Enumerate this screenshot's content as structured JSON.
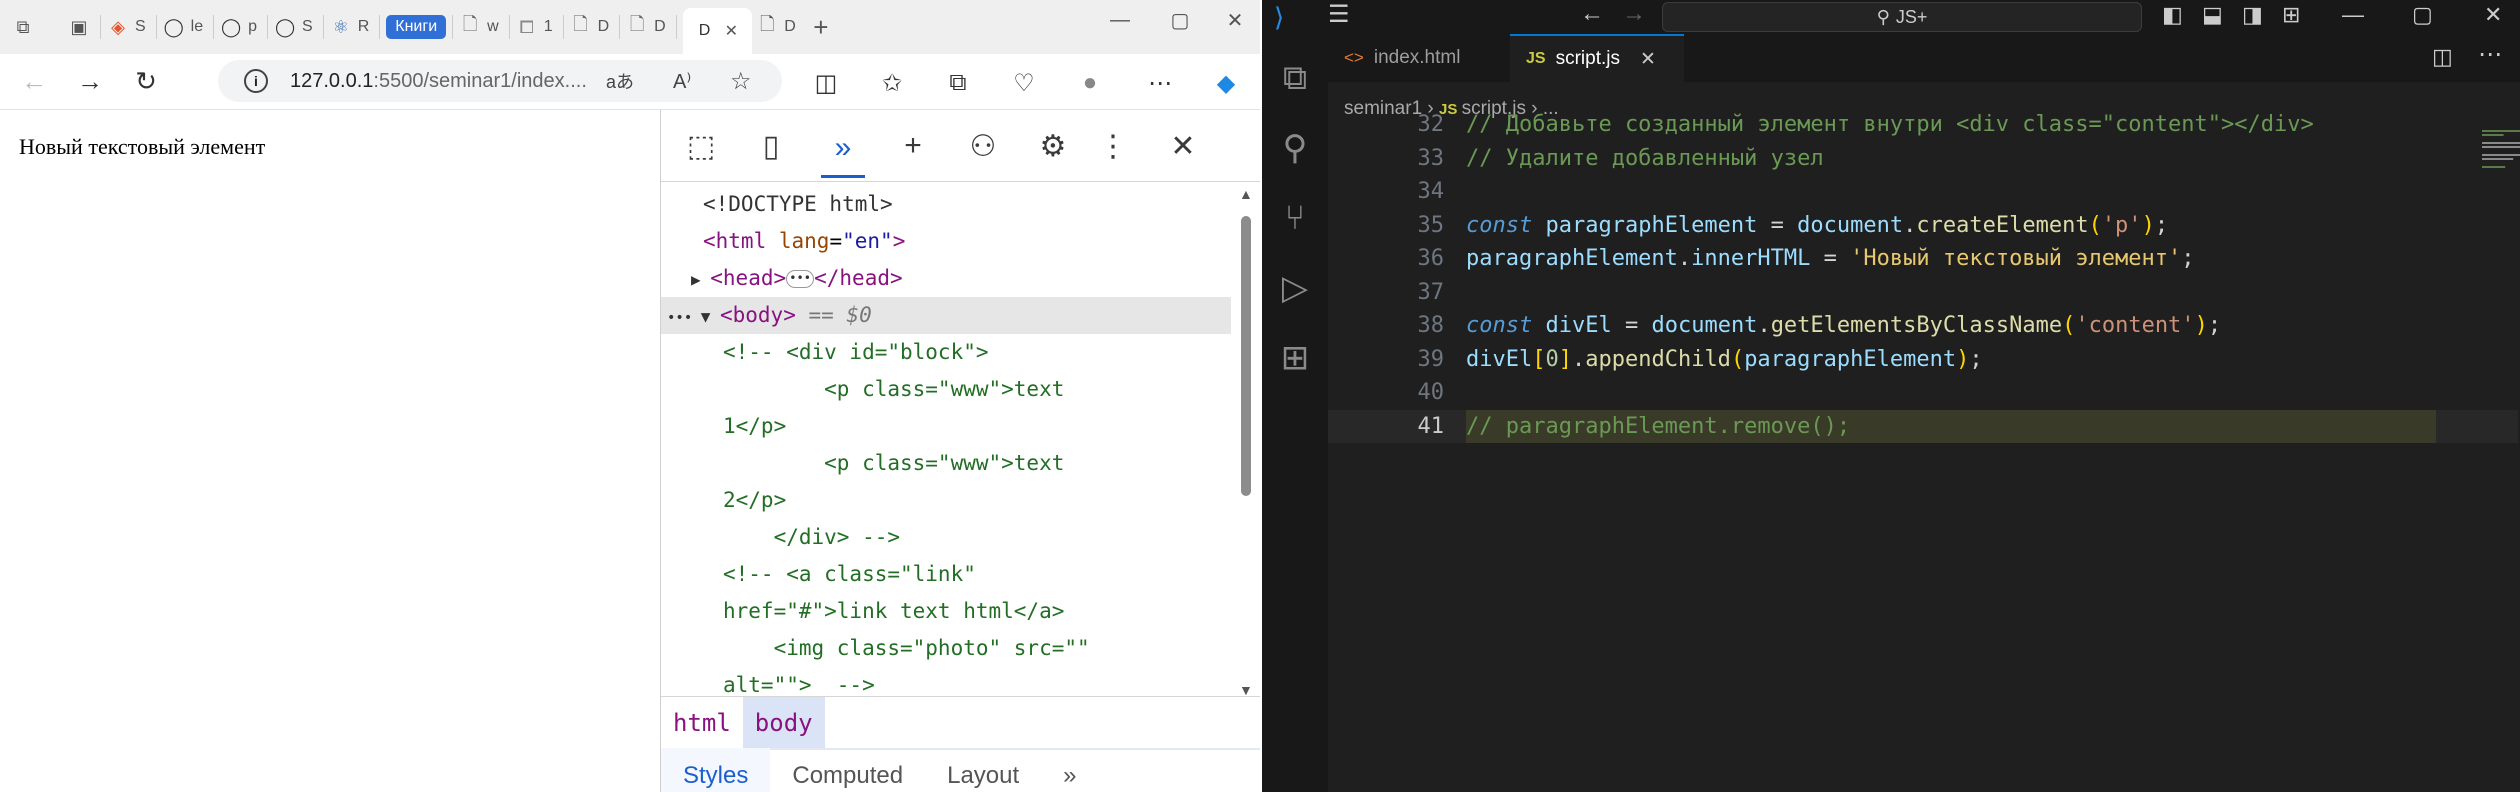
{
  "browser": {
    "tabs": [
      {
        "icon": "figma-icon",
        "title": "S"
      },
      {
        "icon": "github-icon",
        "title": "le"
      },
      {
        "icon": "github-icon",
        "title": "p"
      },
      {
        "icon": "github-icon",
        "title": "S"
      },
      {
        "icon": "react-icon",
        "title": "R"
      },
      {
        "icon": "doc-icon",
        "title": "w"
      },
      {
        "icon": "puzzle-icon",
        "title": "1"
      },
      {
        "icon": "doc-icon",
        "title": "D"
      },
      {
        "icon": "doc-icon",
        "title": "D"
      },
      {
        "icon": "doc-icon",
        "title": "D"
      },
      {
        "icon": "doc-icon",
        "title": "D"
      }
    ],
    "tab_group_label": "Книги",
    "url_host": "127.0.0.1",
    "url_rest": ":5500/seminar1/index....",
    "read_aloud": "aあ",
    "page_text": "Новый текстовый элемент"
  },
  "devtools": {
    "dom_lines": [
      {
        "kind": "doctype",
        "text": "<!DOCTYPE html>"
      },
      {
        "kind": "html",
        "open": "<html",
        "attr": "lang",
        "val": "\"en\"",
        "close": ">"
      },
      {
        "kind": "head",
        "open": "<head>",
        "close": "</head>"
      },
      {
        "kind": "body",
        "open": "<body>",
        "eq": "== $0"
      },
      {
        "kind": "cmt",
        "text": "<!-- <div id=\"block\">"
      },
      {
        "kind": "cmt",
        "text": "        <p class=\"www\">text"
      },
      {
        "kind": "cmt",
        "text": "1</p>"
      },
      {
        "kind": "cmt",
        "text": "        <p class=\"www\">text"
      },
      {
        "kind": "cmt",
        "text": "2</p>"
      },
      {
        "kind": "cmt",
        "text": "    </div> -->"
      },
      {
        "kind": "cmt",
        "text": "<!-- <a class=\"link\""
      },
      {
        "kind": "cmt",
        "text": "href=\"#\">link text html</a>"
      },
      {
        "kind": "cmt",
        "text": "    <img class=\"photo\" src=\"\""
      },
      {
        "kind": "cmt",
        "text": "alt=\"\">  -->"
      }
    ],
    "crumbs": [
      "html",
      "body"
    ],
    "style_tabs": [
      "Styles",
      "Computed",
      "Layout"
    ]
  },
  "vscode": {
    "search": "JS+",
    "tabs": [
      {
        "icon": "html-icon",
        "label": "index.html"
      },
      {
        "icon": "js-icon",
        "label": "script.js"
      }
    ],
    "breadcrumb_folder": "seminar1",
    "breadcrumb_file": "script.js",
    "breadcrumb_more": "...",
    "lines": [
      {
        "n": "32",
        "tokens": [
          {
            "c": "vcm",
            "t": "// Добавьте созданный элемент внутри <div class=\"content\"></div>"
          }
        ]
      },
      {
        "n": "33",
        "tokens": [
          {
            "c": "vcm",
            "t": "// Удалите добавленный узел"
          }
        ]
      },
      {
        "n": "34",
        "tokens": []
      },
      {
        "n": "35",
        "tokens": [
          {
            "c": "kw",
            "t": "const "
          },
          {
            "c": "var",
            "t": "paragraphElement "
          },
          {
            "c": "op",
            "t": "= "
          },
          {
            "c": "var",
            "t": "document"
          },
          {
            "c": "op",
            "t": "."
          },
          {
            "c": "fn",
            "t": "createElement"
          },
          {
            "c": "br1",
            "t": "("
          },
          {
            "c": "str",
            "t": "'p'"
          },
          {
            "c": "br1",
            "t": ")"
          },
          {
            "c": "op",
            "t": ";"
          }
        ]
      },
      {
        "n": "36",
        "tokens": [
          {
            "c": "var",
            "t": "paragraphElement"
          },
          {
            "c": "op",
            "t": "."
          },
          {
            "c": "var",
            "t": "innerHTML "
          },
          {
            "c": "op",
            "t": "= "
          },
          {
            "c": "strwarm",
            "t": "'Новый текстовый элемент'"
          },
          {
            "c": "op",
            "t": ";"
          }
        ]
      },
      {
        "n": "37",
        "tokens": []
      },
      {
        "n": "38",
        "tokens": [
          {
            "c": "kw",
            "t": "const "
          },
          {
            "c": "var",
            "t": "divEl "
          },
          {
            "c": "op",
            "t": "= "
          },
          {
            "c": "var",
            "t": "document"
          },
          {
            "c": "op",
            "t": "."
          },
          {
            "c": "fn",
            "t": "getElementsByClassName"
          },
          {
            "c": "br1",
            "t": "("
          },
          {
            "c": "str",
            "t": "'content'"
          },
          {
            "c": "br1",
            "t": ")"
          },
          {
            "c": "op",
            "t": ";"
          }
        ]
      },
      {
        "n": "39",
        "tokens": [
          {
            "c": "var",
            "t": "divEl"
          },
          {
            "c": "br1",
            "t": "["
          },
          {
            "c": "num",
            "t": "0"
          },
          {
            "c": "br1",
            "t": "]"
          },
          {
            "c": "op",
            "t": "."
          },
          {
            "c": "fn",
            "t": "appendChild"
          },
          {
            "c": "br1",
            "t": "("
          },
          {
            "c": "var",
            "t": "paragraphElement"
          },
          {
            "c": "br1",
            "t": ")"
          },
          {
            "c": "op",
            "t": ";"
          }
        ]
      },
      {
        "n": "40",
        "tokens": []
      },
      {
        "n": "41",
        "tokens": [
          {
            "c": "vcm",
            "t": "// paragraphElement.remove();"
          }
        ]
      }
    ],
    "current_line": "41"
  }
}
